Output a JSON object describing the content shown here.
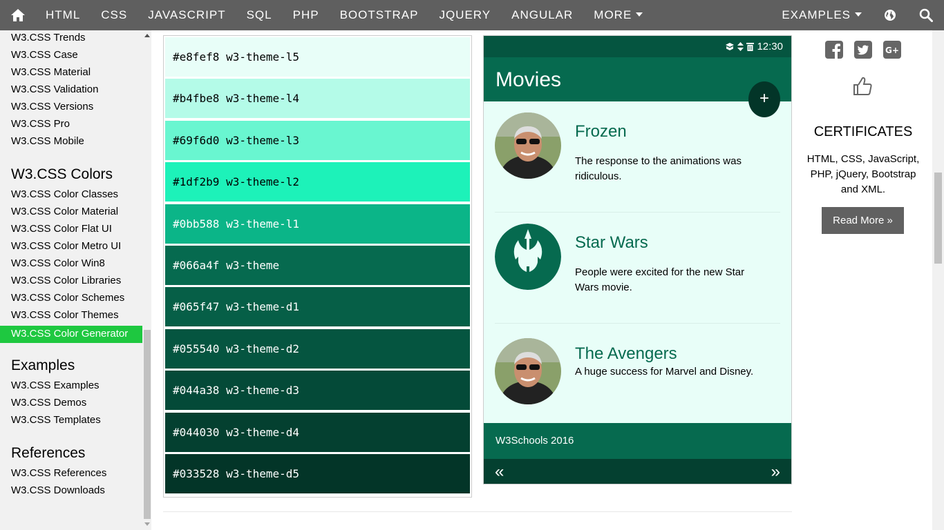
{
  "nav": {
    "items": [
      "HTML",
      "CSS",
      "JAVASCRIPT",
      "SQL",
      "PHP",
      "BOOTSTRAP",
      "JQUERY",
      "ANGULAR"
    ],
    "more_label": "MORE",
    "examples_label": "EXAMPLES"
  },
  "sidebar": {
    "group1": [
      "W3.CSS Trends",
      "W3.CSS Case",
      "W3.CSS Material",
      "W3.CSS Validation",
      "W3.CSS Versions",
      "W3.CSS Pro",
      "W3.CSS Mobile"
    ],
    "colors_heading": "W3.CSS Colors",
    "colors": [
      "W3.CSS Color Classes",
      "W3.CSS Color Material",
      "W3.CSS Color Flat UI",
      "W3.CSS Color Metro UI",
      "W3.CSS Color Win8",
      "W3.CSS Color Libraries",
      "W3.CSS Color Schemes",
      "W3.CSS Color Themes"
    ],
    "active": "W3.CSS Color Generator",
    "examples_heading": "Examples",
    "examples": [
      "W3.CSS Examples",
      "W3.CSS Demos",
      "W3.CSS Templates"
    ],
    "references_heading": "References",
    "references": [
      "W3.CSS References",
      "W3.CSS Downloads"
    ]
  },
  "swatches": [
    {
      "hex": "#e8fef8",
      "label": "#e8fef8 w3-theme-l5",
      "text_color": "#000000"
    },
    {
      "hex": "#b4fbe8",
      "label": "#b4fbe8 w3-theme-l4",
      "text_color": "#000000"
    },
    {
      "hex": "#69f6d0",
      "label": "#69f6d0 w3-theme-l3",
      "text_color": "#000000"
    },
    {
      "hex": "#1df2b9",
      "label": "#1df2b9 w3-theme-l2",
      "text_color": "#000000"
    },
    {
      "hex": "#0bb588",
      "label": "#0bb588 w3-theme-l1",
      "text_color": "#ffffff"
    },
    {
      "hex": "#066a4f",
      "label": "#066a4f w3-theme",
      "text_color": "#ffffff"
    },
    {
      "hex": "#065f47",
      "label": "#065f47 w3-theme-d1",
      "text_color": "#ffffff"
    },
    {
      "hex": "#055540",
      "label": "#055540 w3-theme-d2",
      "text_color": "#ffffff"
    },
    {
      "hex": "#044a38",
      "label": "#044a38 w3-theme-d3",
      "text_color": "#ffffff"
    },
    {
      "hex": "#044030",
      "label": "#044030 w3-theme-d4",
      "text_color": "#ffffff"
    },
    {
      "hex": "#033528",
      "label": "#033528 w3-theme-d5",
      "text_color": "#ffffff"
    }
  ],
  "phone": {
    "time": "12:30",
    "app_title": "Movies",
    "fab_label": "+",
    "movies": [
      {
        "title": "Frozen",
        "desc": "The response to the animations was ridiculous."
      },
      {
        "title": "Star Wars",
        "desc": "People were excited for the new Star Wars movie."
      },
      {
        "title": "The Avengers",
        "desc": "A huge success for Marvel and Disney."
      }
    ],
    "footer": "W3Schools 2016",
    "prev": "«",
    "next": "»"
  },
  "right": {
    "cert_title": "CERTIFICATES",
    "cert_text": "HTML, CSS, JavaScript, PHP, jQuery, Bootstrap and XML.",
    "read_more": "Read More »"
  }
}
